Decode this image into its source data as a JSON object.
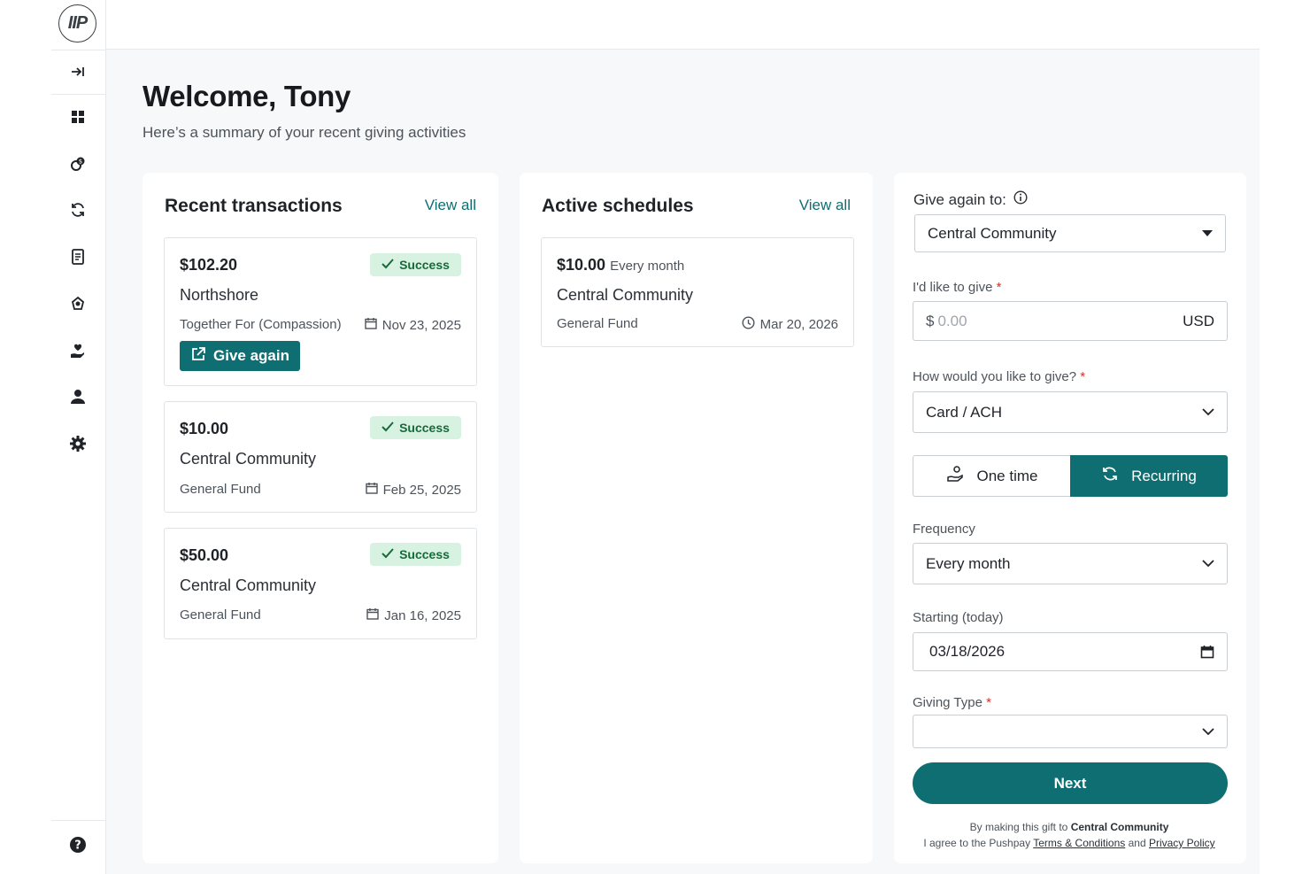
{
  "logo": {
    "text": "IIP"
  },
  "sidebar": {
    "items": [
      {
        "name": "collapse",
        "icon": "collapse-arrow-icon"
      },
      {
        "name": "dashboard",
        "icon": "grid-icon"
      },
      {
        "name": "giving",
        "icon": "coins-icon"
      },
      {
        "name": "recurring",
        "icon": "refresh-icon"
      },
      {
        "name": "statements",
        "icon": "document-icon"
      },
      {
        "name": "funds",
        "icon": "hand-seed-icon"
      },
      {
        "name": "charity",
        "icon": "hand-heart-icon"
      },
      {
        "name": "profile",
        "icon": "person-icon"
      },
      {
        "name": "settings",
        "icon": "gear-icon"
      },
      {
        "name": "help",
        "icon": "question-icon"
      }
    ]
  },
  "header": {
    "welcome": "Welcome, Tony",
    "subtitle": "Here’s a summary of your recent giving activities"
  },
  "recent": {
    "title": "Recent transactions",
    "view_all": "View all",
    "give_again": "Give again",
    "items": [
      {
        "amount": "$102.20",
        "status": "Success",
        "org": "Northshore",
        "fund": "Together For (Compassion)",
        "date": "Nov 23, 2025"
      },
      {
        "amount": "$10.00",
        "status": "Success",
        "org": "Central Community",
        "fund": "General Fund",
        "date": "Feb 25, 2025"
      },
      {
        "amount": "$50.00",
        "status": "Success",
        "org": "Central Community",
        "fund": "General Fund",
        "date": "Jan 16, 2025"
      }
    ]
  },
  "schedules": {
    "title": "Active schedules",
    "view_all": "View all",
    "items": [
      {
        "amount": "$10.00",
        "frequency": "Every month",
        "org": "Central Community",
        "fund": "General Fund",
        "date": "Mar 20, 2026"
      }
    ]
  },
  "give_form": {
    "give_again_label": "Give again to:",
    "recipient": "Central Community",
    "amount_label": "I'd like to give",
    "currency_symbol": "$",
    "amount_placeholder": "0.00",
    "currency": "USD",
    "method_label": "How would you like to give?",
    "method": "Card / ACH",
    "one_time": "One time",
    "recurring": "Recurring",
    "selected_mode": "Recurring",
    "frequency_label": "Frequency",
    "frequency": "Every month",
    "starting_label": "Starting (today)",
    "starting_date": "03/18/2026",
    "giving_type_label": "Giving Type",
    "giving_type": "",
    "required_mark": "*",
    "next": "Next",
    "legal_prefix": "By making this gift to",
    "legal_org": "Central Community",
    "legal_agree": "I agree to the Pushpay",
    "terms": "Terms & Conditions",
    "and": "and",
    "privacy": "Privacy Policy"
  },
  "colors": {
    "accent": "#0e6e72",
    "success_bg": "#d8f2e2",
    "success_text": "#17693a",
    "required": "#d93025"
  }
}
